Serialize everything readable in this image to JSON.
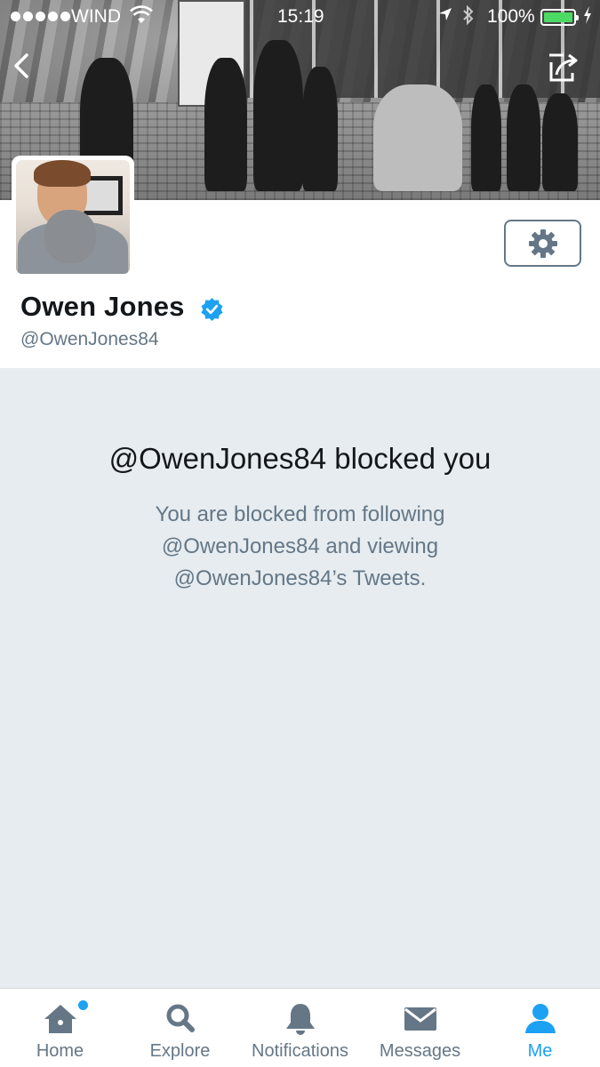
{
  "status_bar": {
    "carrier": "WIND",
    "time": "15:19",
    "battery_percent": "100%",
    "battery_level": 1.0,
    "battery_color": "#4cd964"
  },
  "navigation": {
    "back_icon": "chevron-left-icon",
    "share_icon": "share-icon"
  },
  "profile": {
    "display_name": "Owen Jones",
    "handle": "@OwenJones84",
    "verified": true,
    "verified_color": "#1da1f2",
    "settings_icon": "gear-icon"
  },
  "blocked": {
    "title": "@OwenJones84 blocked you",
    "line1": "You are blocked from following",
    "line2": "@OwenJones84 and viewing",
    "line3": "@OwenJones84’s Tweets."
  },
  "tabs": [
    {
      "label": "Home",
      "icon": "home-icon",
      "active": false,
      "has_notification_dot": true
    },
    {
      "label": "Explore",
      "icon": "search-icon",
      "active": false
    },
    {
      "label": "Notifications",
      "icon": "bell-icon",
      "active": false
    },
    {
      "label": "Messages",
      "icon": "envelope-icon",
      "active": false
    },
    {
      "label": "Me",
      "icon": "person-icon",
      "active": true
    }
  ],
  "colors": {
    "accent": "#1da1f2",
    "text_primary": "#14171a",
    "text_secondary": "#657786",
    "background": "#e6ecf0"
  }
}
